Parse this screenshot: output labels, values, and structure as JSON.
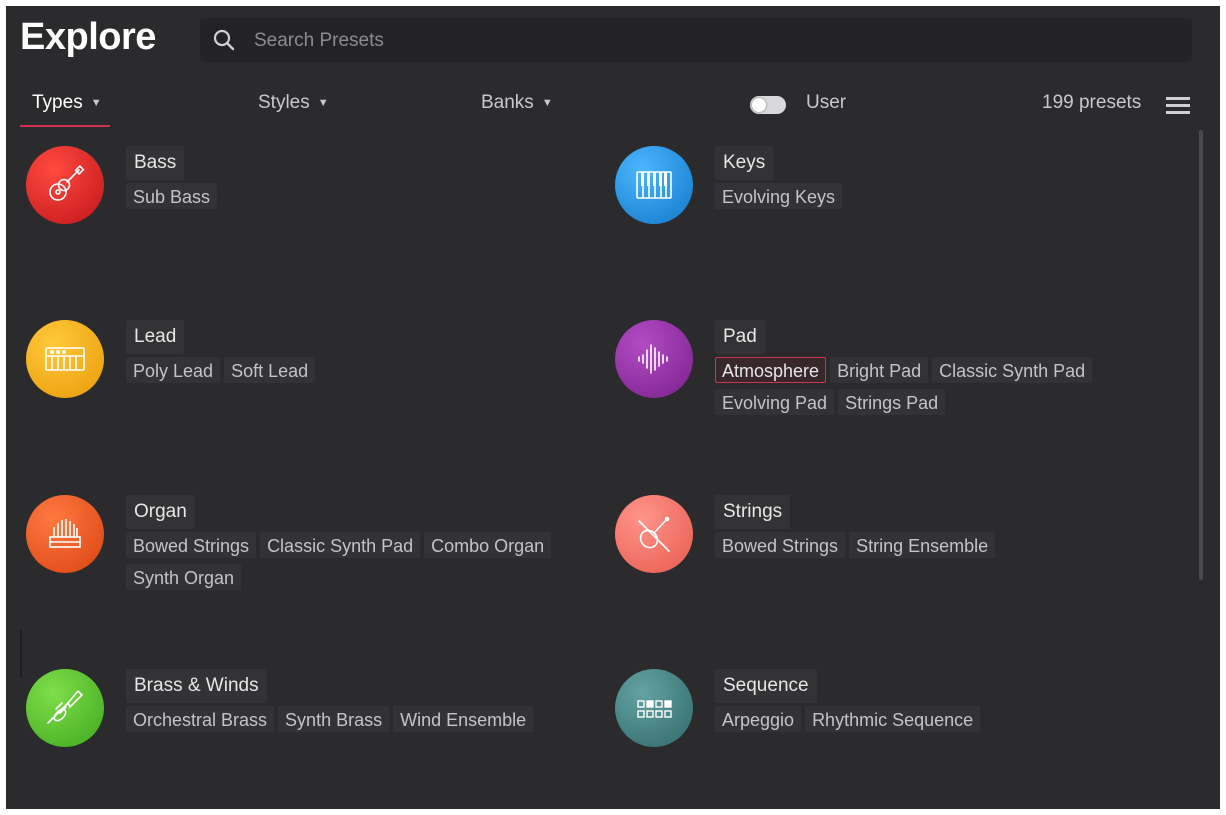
{
  "header": {
    "title": "Explore",
    "search_placeholder": "Search Presets"
  },
  "filters": {
    "types": "Types",
    "styles": "Styles",
    "banks": "Banks",
    "user": "User",
    "user_toggle_on": false,
    "count": "199 presets"
  },
  "colors": {
    "accent": "#d0314f",
    "background": "#2b2b2d",
    "bass": "#d41f22",
    "keys": "#1a8fe0",
    "lead": "#f2a811",
    "pad": "#8e2d9e",
    "organ": "#e9501c",
    "strings": "#f06f62",
    "brass_winds": "#5ac42c",
    "sequence": "#3f7d7d"
  },
  "categories": {
    "bass": {
      "title": "Bass",
      "icon": "acoustic-guitar-icon",
      "tags": [
        "Sub Bass"
      ]
    },
    "keys": {
      "title": "Keys",
      "icon": "piano-keys-icon",
      "tags": [
        "Evolving Keys"
      ]
    },
    "lead": {
      "title": "Lead",
      "icon": "synth-keyboard-icon",
      "tags": [
        "Poly Lead",
        "Soft Lead"
      ]
    },
    "pad": {
      "title": "Pad",
      "icon": "waveform-icon",
      "tags": [
        "Atmosphere",
        "Bright Pad",
        "Classic Synth Pad",
        "Evolving Pad",
        "Strings Pad"
      ],
      "selected_tag": "Atmosphere"
    },
    "organ": {
      "title": "Organ",
      "icon": "organ-pipes-icon",
      "tags": [
        "Bowed Strings",
        "Classic Synth Pad",
        "Combo Organ",
        "Synth Organ"
      ]
    },
    "strings": {
      "title": "Strings",
      "icon": "violin-icon",
      "tags": [
        "Bowed Strings",
        "String Ensemble"
      ]
    },
    "brass_winds": {
      "title": "Brass & Winds",
      "icon": "trumpet-icon",
      "tags": [
        "Orchestral Brass",
        "Synth Brass",
        "Wind Ensemble"
      ]
    },
    "sequence": {
      "title": "Sequence",
      "icon": "step-sequencer-icon",
      "tags": [
        "Arpeggio",
        "Rhythmic Sequence"
      ]
    }
  }
}
